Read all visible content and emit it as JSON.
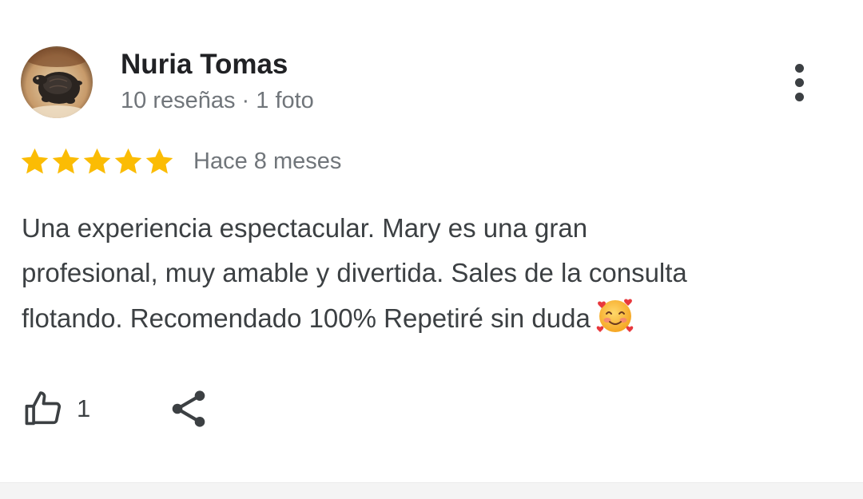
{
  "review": {
    "author": {
      "name": "Nuria Tomas",
      "meta": "10 reseñas · 1 foto"
    },
    "rating": 5,
    "rating_max": 5,
    "date": "Hace 8 meses",
    "text_lines": [
      "Una experiencia espectacular. Mary es una gran",
      "profesional, muy amable y divertida. Sales de la consulta",
      "flotando. Recomendado 100% Repetiré sin duda"
    ],
    "trailing_emoji": "smiling-face-with-hearts-emoji",
    "likes": "1"
  },
  "icons": {
    "more": "more-vert-icon",
    "like": "thumb-up-icon",
    "share": "share-icon"
  },
  "colors": {
    "star": "#fbbc04",
    "name": "#202124",
    "meta": "#70757a",
    "body": "#3c4043",
    "icon": "#3c4043"
  }
}
